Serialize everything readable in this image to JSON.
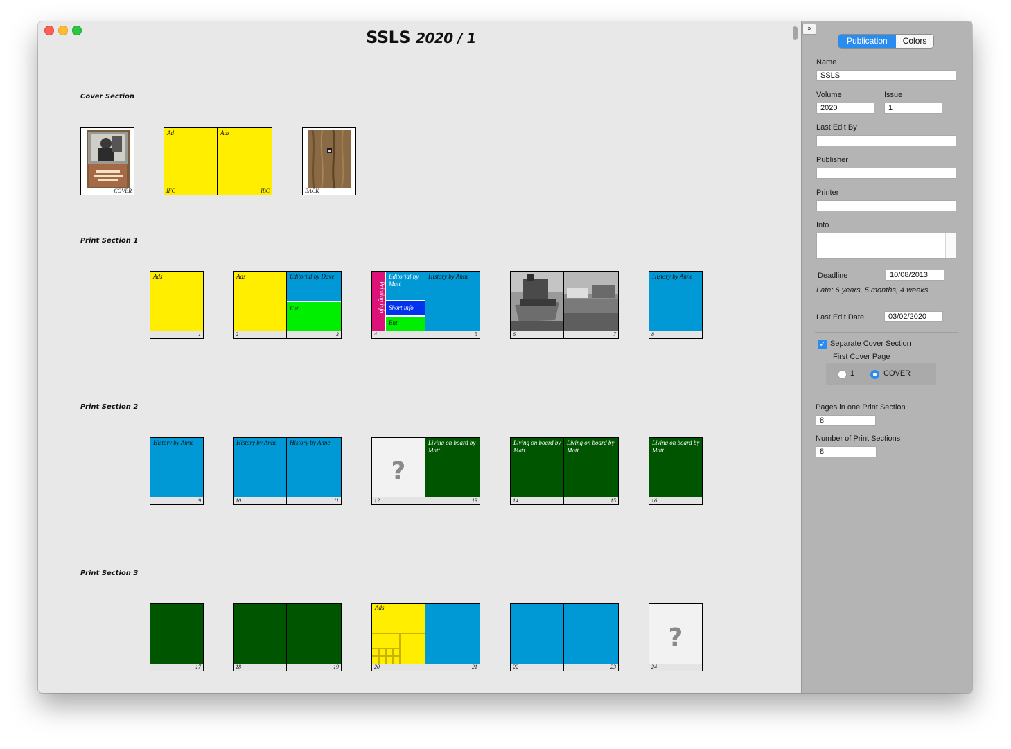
{
  "window": {
    "title_main": "SSLS",
    "title_sub": "2020 / 1"
  },
  "sections": {
    "cover": "Cover Section",
    "print1": "Print Section 1",
    "print2": "Print Section 2",
    "print3": "Print Section 3"
  },
  "cover_pages": {
    "cover": "COVER",
    "ifc": "IFC",
    "ibc": "IBC",
    "back": "BACK"
  },
  "articles": {
    "ad": "Ad",
    "ads": "Ads",
    "editorial_dave": "Editorial by Dave",
    "ent": "Ent",
    "editorial_matt": "Editorial by Matt",
    "printing_info": "Printing info",
    "short_info": "Short info",
    "history_anne": "History by Anne",
    "living_matt": "Living on board by Matt"
  },
  "page_numbers": [
    "1",
    "2",
    "3",
    "4",
    "5",
    "6",
    "7",
    "8",
    "9",
    "10",
    "11",
    "12",
    "13",
    "14",
    "15",
    "16",
    "17",
    "18",
    "19",
    "20",
    "21",
    "22",
    "23",
    "24"
  ],
  "unknown_mark": "?",
  "colors": {
    "ads_yellow": "#ffee00",
    "history_blue": "#0099d6",
    "ent_green": "#00ee00",
    "living_dark_green": "#005500",
    "short_info_blue": "#0033ee",
    "printing_magenta": "#dd1177",
    "accent_blue": "#2a8bf0"
  },
  "panel": {
    "collapse": "»",
    "tabs": {
      "publication": "Publication",
      "colors": "Colors",
      "active": "Publication"
    },
    "name_label": "Name",
    "name_value": "SSLS",
    "volume_label": "Volume",
    "volume_value": "2020",
    "issue_label": "Issue",
    "issue_value": "1",
    "last_edit_by_label": "Last Edit By",
    "last_edit_by_value": "",
    "publisher_label": "Publisher",
    "publisher_value": "",
    "printer_label": "Printer",
    "printer_value": "",
    "info_label": "Info",
    "info_value": "",
    "deadline_label": "Deadline",
    "deadline_value": "10/08/2013",
    "late_text": "Late:  6 years, 5 months, 4 weeks",
    "last_edit_date_label": "Last Edit Date",
    "last_edit_date_value": "03/02/2020",
    "separate_cover_label": "Separate Cover Section",
    "separate_cover_checked": true,
    "first_cover_page_label": "First Cover Page",
    "first_cover_options": [
      "1",
      "COVER"
    ],
    "first_cover_selected": "COVER",
    "pages_per_section_label": "Pages in one Print Section",
    "pages_per_section_value": "8",
    "num_sections_label": "Number of Print Sections",
    "num_sections_value": "8"
  }
}
